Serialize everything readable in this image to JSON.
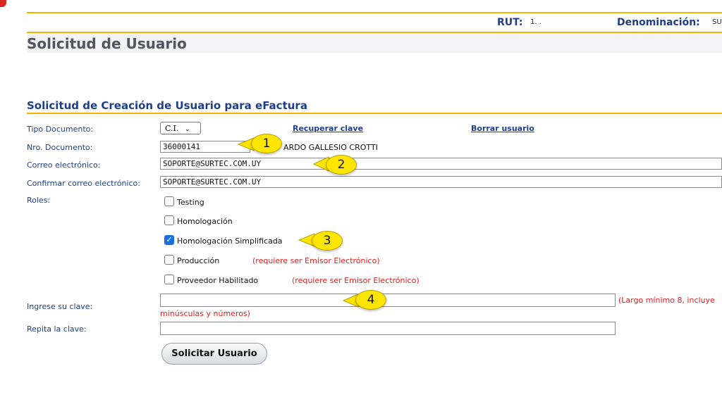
{
  "header": {
    "rut_label": "RUT:",
    "rut_value": "1. .",
    "denominacion_label": "Denominación:",
    "denominacion_value": "SU"
  },
  "page": {
    "title": "Solicitud de Usuario",
    "section_title": "Solicitud de Creación de Usuario para eFactura"
  },
  "form": {
    "tipo_documento_label": "Tipo Documento:",
    "tipo_documento_value": "C.I.",
    "recuperar_clave": "Recuperar clave",
    "borrar_usuario": "Borrar usuario",
    "nro_documento_label": "Nro. Documento:",
    "nro_documento_value": "36000141",
    "nombre": "ARDO GALLESIO CROTTI",
    "correo_label": "Correo electrónico:",
    "correo_value": "SOPORTE@SURTEC.COM.UY",
    "confirmar_correo_label": "Confirmar correo electrónico:",
    "confirmar_correo_value": "SOPORTE@SURTEC.COM.UY",
    "roles_label": "Roles:",
    "roles": [
      {
        "label": "Testing",
        "checked": false,
        "note": ""
      },
      {
        "label": "Homologación",
        "checked": false,
        "note": ""
      },
      {
        "label": "Homologación Simplificada",
        "checked": true,
        "note": ""
      },
      {
        "label": "Producción",
        "checked": false,
        "note": "(requiere ser Emisor Electrónico)"
      },
      {
        "label": "Proveedor Habilitado",
        "checked": false,
        "note": "(requiere ser Emisor Electrónico)"
      }
    ],
    "clave_label": "Ingrese su clave:",
    "clave_hint_1": "(Largo mínimo 8, incluye",
    "clave_hint_2": "minúsculas y números)",
    "repita_label": "Repita la clave:",
    "submit_label": "Solicitar Usuario"
  },
  "callouts": [
    "1",
    "2",
    "3",
    "4"
  ],
  "colors": {
    "accent_line": "#f5b400",
    "label_blue": "#1f3d8a",
    "warning_red": "#e0201c",
    "callout_yellow": "#ffe600",
    "checkbox_blue": "#1a6fe0"
  }
}
